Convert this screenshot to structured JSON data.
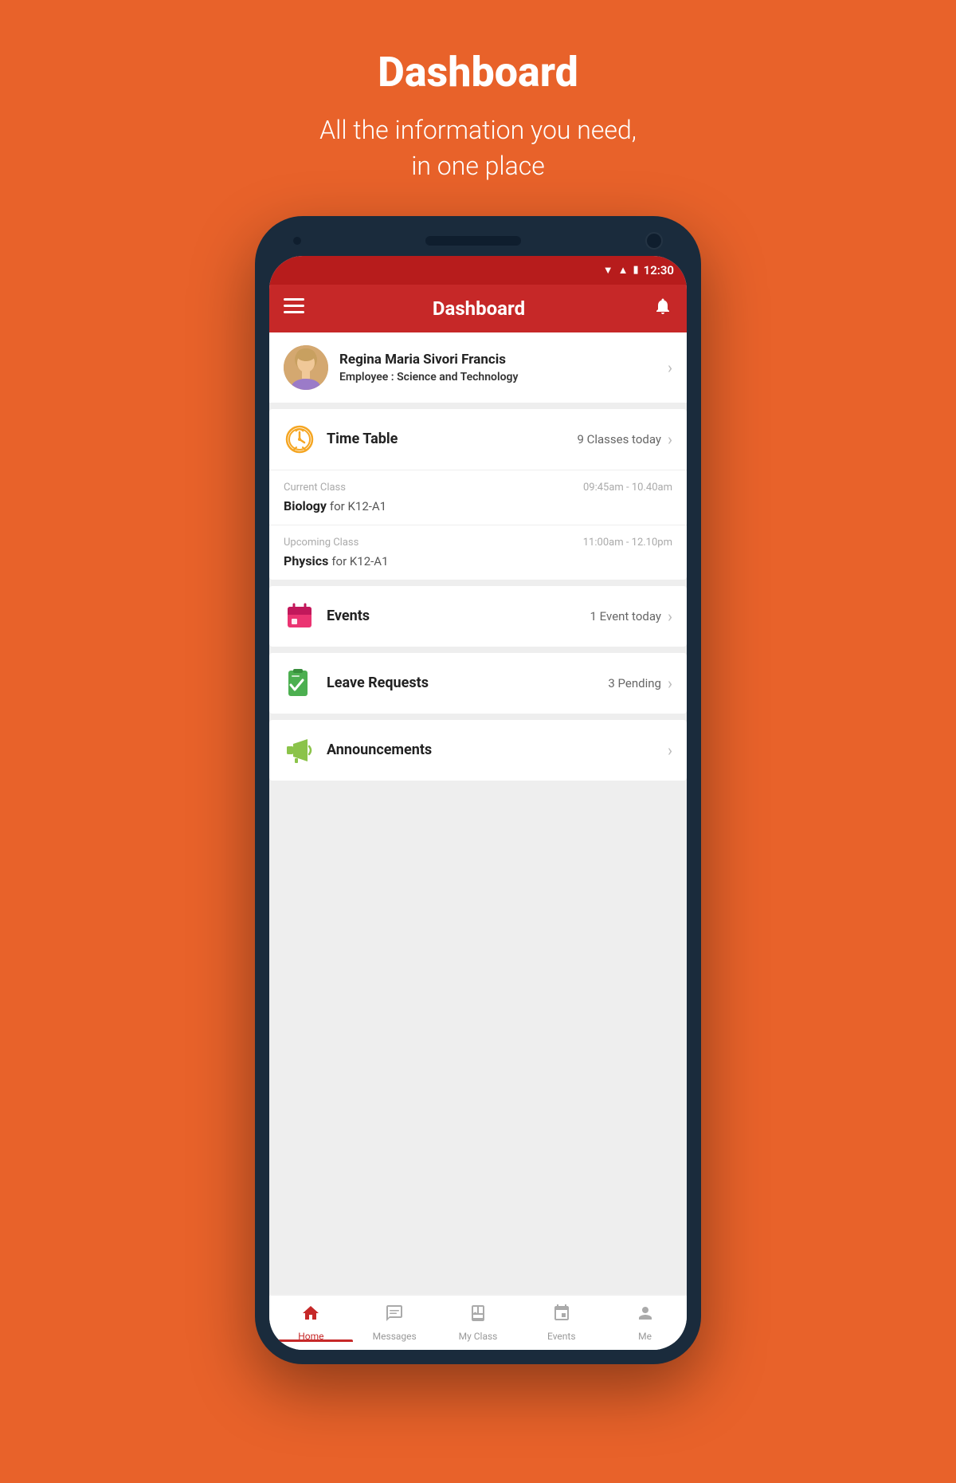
{
  "page": {
    "title": "Dashboard",
    "subtitle_line1": "All the information you need,",
    "subtitle_line2": "in one place"
  },
  "status_bar": {
    "time": "12:30"
  },
  "app_bar": {
    "title": "Dashboard",
    "menu_icon": "☰",
    "bell_icon": "🔔"
  },
  "profile": {
    "name": "Regina Maria Sivori Francis",
    "role_label": "Employee : ",
    "role_value": "Science and Technology"
  },
  "timetable_card": {
    "title": "Time Table",
    "subtitle": "9 Classes today",
    "current_class": {
      "type": "Current Class",
      "time": "09:45am - 10.40am",
      "subject": "Biology",
      "for_text": " for K12-A1"
    },
    "upcoming_class": {
      "type": "Upcoming Class",
      "time": "11:00am - 12.10pm",
      "subject": "Physics",
      "for_text": " for K12-A1"
    }
  },
  "events_card": {
    "title": "Events",
    "subtitle": "1 Event today"
  },
  "leave_requests_card": {
    "title": "Leave Requests",
    "subtitle": "3 Pending"
  },
  "announcements_card": {
    "title": "Announcements"
  },
  "bottom_nav": {
    "items": [
      {
        "id": "home",
        "label": "Home",
        "active": true
      },
      {
        "id": "messages",
        "label": "Messages",
        "active": false
      },
      {
        "id": "myclass",
        "label": "My Class",
        "active": false
      },
      {
        "id": "events",
        "label": "Events",
        "active": false
      },
      {
        "id": "me",
        "label": "Me",
        "active": false
      }
    ]
  },
  "colors": {
    "primary": "#c62828",
    "orange_bg": "#E8622A",
    "dark_navy": "#1a2b3c"
  }
}
